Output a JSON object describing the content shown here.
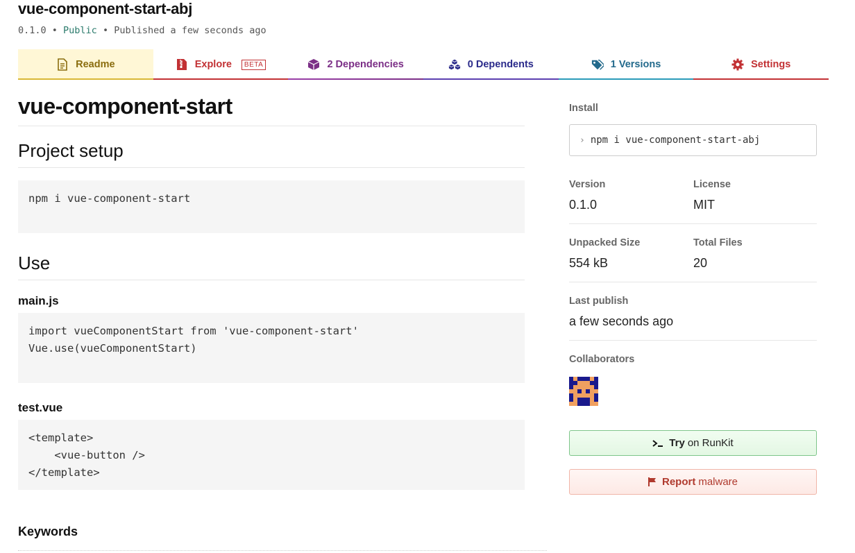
{
  "package": {
    "name": "vue-component-start-abj",
    "version": "0.1.0",
    "sep1": " • ",
    "visibility": "Public",
    "sep2": " • ",
    "published": "Published a few seconds ago"
  },
  "tabs": [
    {
      "label": "Readme",
      "icon": "file-text-icon",
      "color": "#8a6d0e"
    },
    {
      "label": "Explore",
      "badge": "BETA",
      "icon": "file-zip-icon",
      "color": "#c23134"
    },
    {
      "label": "2 Dependencies",
      "icon": "box-icon",
      "color": "#7b2e86"
    },
    {
      "label": "0 Dependents",
      "icon": "boxes-icon",
      "color": "#2a2a8a"
    },
    {
      "label": "1 Versions",
      "icon": "tags-icon",
      "color": "#236a8c"
    },
    {
      "label": "Settings",
      "icon": "gear-icon",
      "color": "#c23134"
    }
  ],
  "readme": {
    "title": "vue-component-start",
    "setup_heading": "Project setup",
    "setup_code": "npm i vue-component-start",
    "use_heading": "Use",
    "main_heading": "main.js",
    "main_code": "import vueComponentStart from 'vue-component-start'\nVue.use(vueComponentStart)",
    "test_heading": "test.vue",
    "test_code": "<template>\n    <vue-button />\n</template>",
    "keywords_heading": "Keywords"
  },
  "sidebar": {
    "install_label": "Install",
    "install_cmd": "npm i vue-component-start-abj",
    "version_label": "Version",
    "version_value": "0.1.0",
    "license_label": "License",
    "license_value": "MIT",
    "unpacked_label": "Unpacked Size",
    "unpacked_value": "554 kB",
    "files_label": "Total Files",
    "files_value": "20",
    "publish_label": "Last publish",
    "publish_value": "a few seconds ago",
    "collab_label": "Collaborators",
    "runkit_bold": "Try",
    "runkit_rest": "on RunKit",
    "malware_bold": "Report",
    "malware_rest": "malware"
  }
}
